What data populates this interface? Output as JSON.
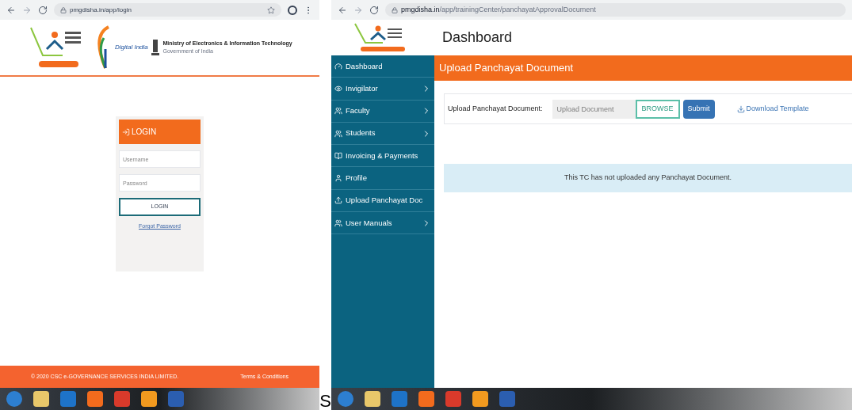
{
  "left_window": {
    "address": "pmgdisha.in/app/login",
    "header": {
      "digital_india": "Digital India",
      "ministry": "Ministry of Electronics & Information Technology",
      "government": "Government of India"
    },
    "login": {
      "title": "LOGIN",
      "username_placeholder": "Username",
      "password_placeholder": "Password",
      "button": "LOGIN",
      "forgot": "Forgot Password"
    },
    "footer": {
      "copyright": "© 2020 CSC e-GOVERNANCE SERVICES INDIA LIMITED.",
      "terms": "Terms & Conditions"
    }
  },
  "separator_letter": "S",
  "right_window": {
    "address_host": "pmgdisha.in",
    "address_path": "/app/trainingCenter/panchayatApprovalDocument",
    "page_title": "Dashboard",
    "sidebar": [
      {
        "label": "Dashboard",
        "expandable": false
      },
      {
        "label": "Invigilator",
        "expandable": true
      },
      {
        "label": "Faculty",
        "expandable": true
      },
      {
        "label": "Students",
        "expandable": true
      },
      {
        "label": "Invoicing & Payments",
        "expandable": false
      },
      {
        "label": "Profile",
        "expandable": false
      },
      {
        "label": "Upload Panchayat Doc",
        "expandable": false
      },
      {
        "label": "User Manuals",
        "expandable": true
      }
    ],
    "section_title": "Upload Panchayat Document",
    "upload": {
      "label": "Upload Panchayat Document:",
      "placeholder": "Upload Document",
      "browse": "BROWSE",
      "submit": "Submit",
      "download": "Download Template"
    },
    "notice": "This TC has not uploaded any Panchayat Document."
  }
}
